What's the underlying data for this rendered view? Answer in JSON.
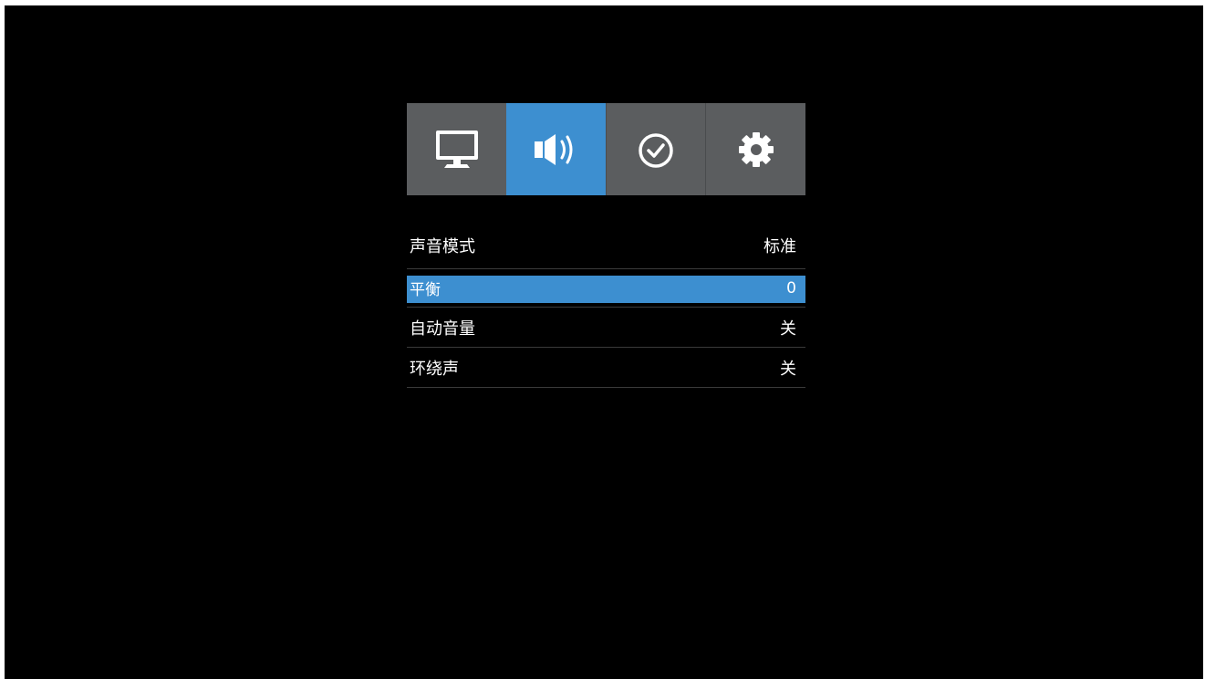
{
  "tabs": [
    {
      "icon": "tv-icon",
      "active": false
    },
    {
      "icon": "speaker-icon",
      "active": true
    },
    {
      "icon": "clock-icon",
      "active": false
    },
    {
      "icon": "gear-icon",
      "active": false
    }
  ],
  "menu": {
    "items": [
      {
        "label": "声音模式",
        "value": "标准"
      },
      {
        "label": "平衡",
        "value": "0"
      },
      {
        "label": "自动音量",
        "value": "关"
      },
      {
        "label": "环绕声",
        "value": "关"
      }
    ]
  },
  "colors": {
    "background": "#000000",
    "tab": "#5b5d5f",
    "active": "#3d8fd0",
    "text": "#ffffff",
    "divider": "#3a3a3a"
  }
}
